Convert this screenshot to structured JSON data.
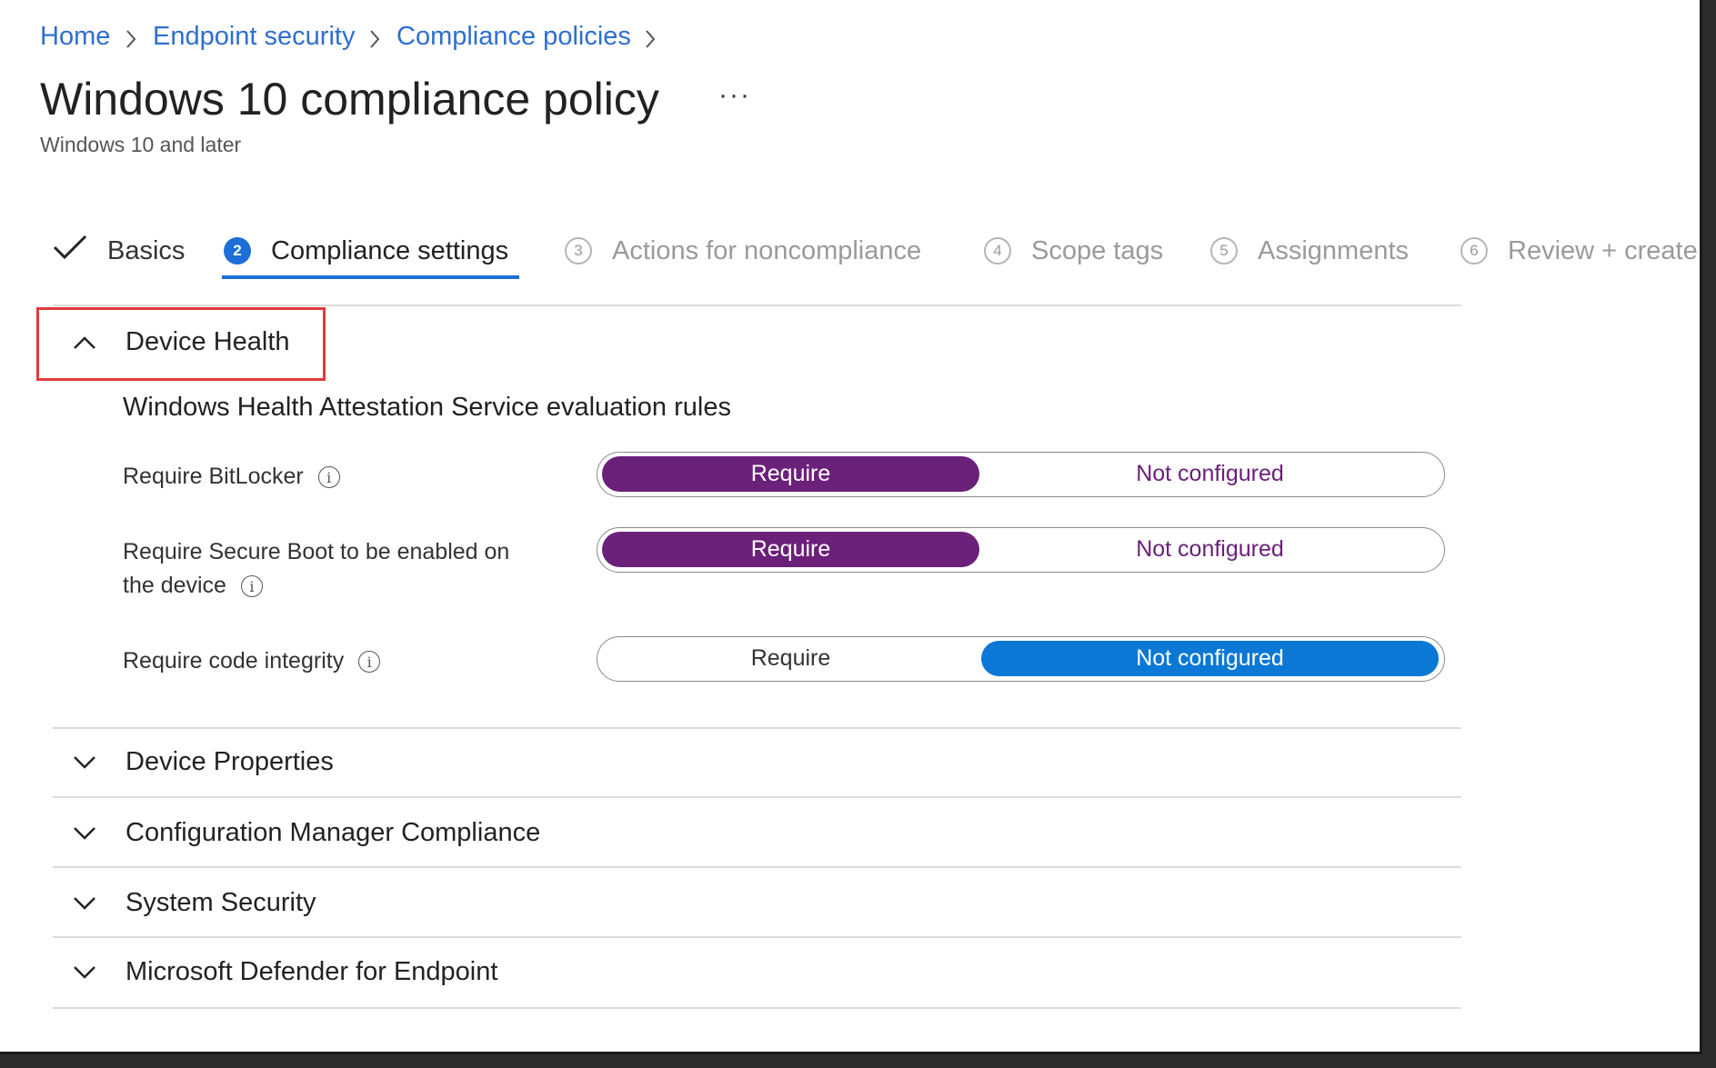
{
  "breadcrumb": {
    "items": [
      "Home",
      "Endpoint security",
      "Compliance policies"
    ]
  },
  "page": {
    "title": "Windows 10 compliance policy",
    "more": "···",
    "subtitle": "Windows 10 and later"
  },
  "wizard": {
    "steps": [
      {
        "num": "",
        "label": "Basics",
        "state": "completed"
      },
      {
        "num": "2",
        "label": "Compliance settings",
        "state": "active"
      },
      {
        "num": "3",
        "label": "Actions for noncompliance",
        "state": "pending"
      },
      {
        "num": "4",
        "label": "Scope tags",
        "state": "pending"
      },
      {
        "num": "5",
        "label": "Assignments",
        "state": "pending"
      },
      {
        "num": "6",
        "label": "Review + create",
        "state": "pending"
      }
    ]
  },
  "sections": {
    "device_health": {
      "label": "Device Health",
      "expanded": true,
      "rules_title": "Windows Health Attestation Service evaluation rules",
      "settings": [
        {
          "label": "Require BitLocker",
          "option_a": "Require",
          "option_b": "Not configured",
          "selected": "Require"
        },
        {
          "label_line1": "Require Secure Boot to be enabled on",
          "label_line2": "the device",
          "option_a": "Require",
          "option_b": "Not configured",
          "selected": "Require"
        },
        {
          "label": "Require code integrity",
          "option_a": "Require",
          "option_b": "Not configured",
          "selected": "Not configured"
        }
      ]
    },
    "collapsed": [
      {
        "label": "Device Properties"
      },
      {
        "label": "Configuration Manager Compliance"
      },
      {
        "label": "System Security"
      },
      {
        "label": "Microsoft Defender for Endpoint"
      }
    ]
  },
  "colors": {
    "link": "#2e6fce",
    "accent_blue": "#1d6ed6",
    "selected_purple": "#6b207a",
    "selected_blue": "#0b78d6",
    "highlight_red": "#e03a3a"
  },
  "icons": {
    "breadcrumb_separator": "chevron-right-icon",
    "completed_step": "checkmark-icon",
    "expanded_section": "chevron-up-icon",
    "collapsed_section": "chevron-down-icon",
    "info": "info-icon"
  }
}
